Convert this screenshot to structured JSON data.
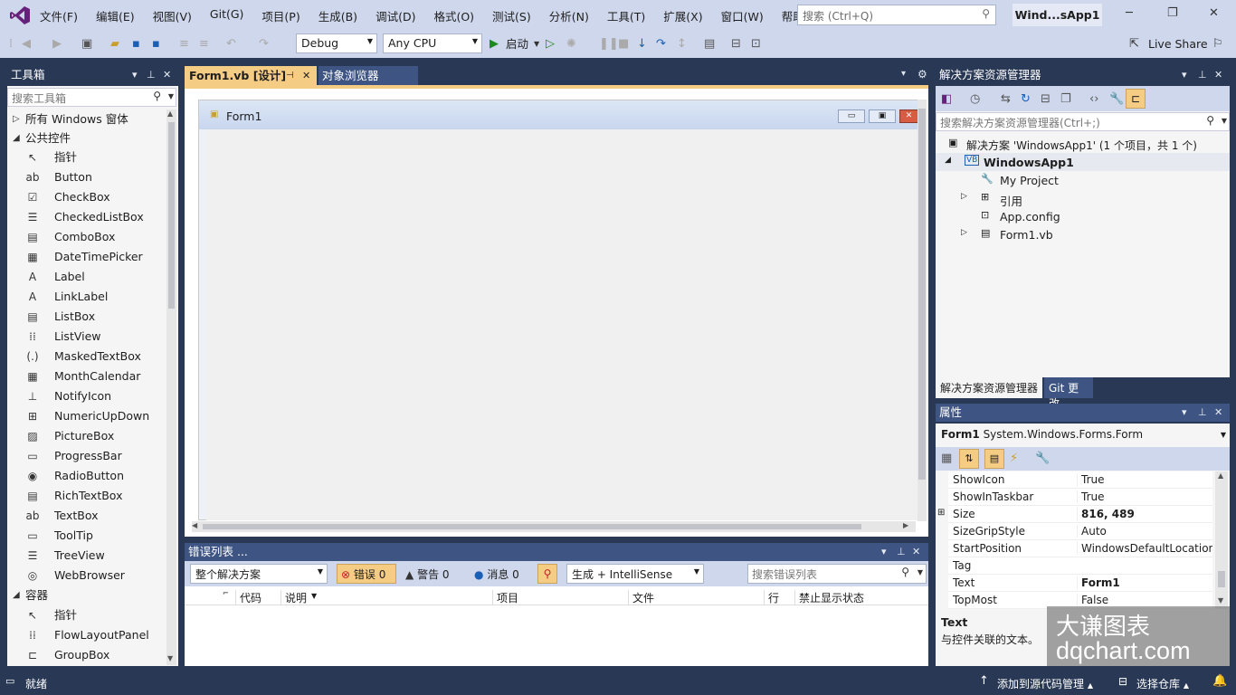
{
  "menubar": {
    "items": [
      "文件(F)",
      "编辑(E)",
      "视图(V)",
      "Git(G)",
      "项目(P)",
      "生成(B)",
      "调试(D)",
      "格式(O)",
      "测试(S)",
      "分析(N)",
      "工具(T)",
      "扩展(X)",
      "窗口(W)",
      "帮助(H)"
    ],
    "search_placeholder": "搜索 (Ctrl+Q)",
    "solution_badge": "Wind...sApp1",
    "live_share": "Live Share"
  },
  "toolbar": {
    "config": "Debug",
    "platform": "Any CPU",
    "start_label": "启动"
  },
  "toolbox": {
    "title": "工具箱",
    "search_placeholder": "搜索工具箱",
    "group_all": "所有 Windows 窗体",
    "group_common": "公共控件",
    "common": [
      "指针",
      "Button",
      "CheckBox",
      "CheckedListBox",
      "ComboBox",
      "DateTimePicker",
      "Label",
      "LinkLabel",
      "ListBox",
      "ListView",
      "MaskedTextBox",
      "MonthCalendar",
      "NotifyIcon",
      "NumericUpDown",
      "PictureBox",
      "ProgressBar",
      "RadioButton",
      "RichTextBox",
      "TextBox",
      "ToolTip",
      "TreeView",
      "WebBrowser"
    ],
    "group_containers": "容器",
    "containers": [
      "指针",
      "FlowLayoutPanel",
      "GroupBox"
    ]
  },
  "tabs": {
    "active": "Form1.vb [设计]",
    "other": "对象浏览器"
  },
  "designer": {
    "form_title": "Form1"
  },
  "errorlist": {
    "title": "错误列表 ...",
    "scope": "整个解决方案",
    "errors": "错误 0",
    "warnings": "警告 0",
    "messages": "消息 0",
    "build_filter": "生成 + IntelliSense",
    "search_placeholder": "搜索错误列表",
    "columns": [
      "代码",
      "说明",
      "项目",
      "文件",
      "行",
      "禁止显示状态"
    ]
  },
  "solution_explorer": {
    "title": "解决方案资源管理器",
    "search_placeholder": "搜索解决方案资源管理器(Ctrl+;)",
    "solution_line": "解决方案 'WindowsApp1' (1 个项目，共 1 个)",
    "project": "WindowsApp1",
    "items": [
      "My Project",
      "引用",
      "App.config",
      "Form1.vb"
    ],
    "tab_active": "解决方案资源管理器",
    "tab_other": "Git 更改"
  },
  "properties": {
    "title": "属性",
    "object_name": "Form1",
    "object_type": "System.Windows.Forms.Form",
    "rows": [
      {
        "name": "ShowIcon",
        "value": "True",
        "bold": false
      },
      {
        "name": "ShowInTaskbar",
        "value": "True",
        "bold": false
      },
      {
        "name": "Size",
        "value": "816, 489",
        "bold": true
      },
      {
        "name": "SizeGripStyle",
        "value": "Auto",
        "bold": false
      },
      {
        "name": "StartPosition",
        "value": "WindowsDefaultLocation",
        "bold": false
      },
      {
        "name": "Tag",
        "value": "",
        "bold": false
      },
      {
        "name": "Text",
        "value": "Form1",
        "bold": true
      },
      {
        "name": "TopMost",
        "value": "False",
        "bold": false
      }
    ],
    "desc_title": "Text",
    "desc_text": "与控件关联的文本。"
  },
  "watermark": {
    "line1": "大谦图表",
    "line2": "dqchart.com"
  },
  "statusbar": {
    "ready": "就绪",
    "add_source": "添加到源代码管理",
    "select_repo": "选择仓库"
  },
  "colors": {
    "accent": "#f5cc84",
    "panel_title": "#293955",
    "vs_purple": "#68217a"
  }
}
